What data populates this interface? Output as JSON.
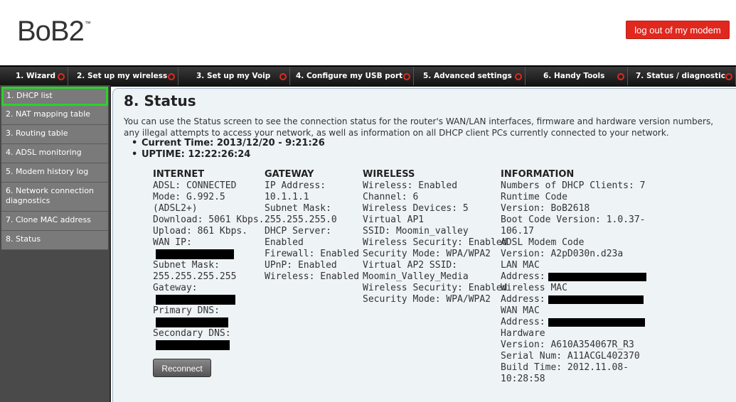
{
  "header": {
    "logo": "BoB2",
    "logo_tm": "™",
    "logout_label": "log out of my modem"
  },
  "topnav": {
    "tabs": [
      {
        "label": "1. Wizard"
      },
      {
        "label": "2. Set up my wireless"
      },
      {
        "label": "3. Set up my Voip"
      },
      {
        "label": "4. Configure my USB port"
      },
      {
        "label": "5. Advanced settings"
      },
      {
        "label": "6. Handy Tools"
      },
      {
        "label": "7. Status / diagnostic"
      }
    ]
  },
  "sidebar": {
    "items": [
      {
        "label": "1. DHCP list"
      },
      {
        "label": "2. NAT mapping table"
      },
      {
        "label": "3. Routing table"
      },
      {
        "label": "4. ADSL monitoring"
      },
      {
        "label": "5. Modem history log"
      },
      {
        "label": "6. Network connection diagnostics"
      },
      {
        "label": "7. Clone MAC address"
      },
      {
        "label": "8. Status"
      }
    ]
  },
  "main": {
    "title": "8. Status",
    "intro": "You can use the Status screen to see the connection status for the router's WAN/LAN interfaces, firmware and hardware version numbers, any illegal attempts to access your network, as well as information on all DHCP client PCs currently connected to your network.",
    "current_time": "Current Time: 2013/12/20 - 9:21:26",
    "uptime": "UPTIME: 12:22:26:24",
    "reconnect_label": "Reconnect",
    "internet": {
      "heading": "INTERNET",
      "adsl": "ADSL:  CONNECTED",
      "mode1": "Mode:  G.992.5",
      "mode2": "(ADSL2+)",
      "download": "Download:  5061 Kbps.",
      "upload": "Upload:  861 Kbps.",
      "wan_ip": "WAN IP:",
      "subnet_label": "Subnet Mask:",
      "subnet_value": " 255.255.255.255",
      "gateway": "Gateway:",
      "primary_dns": "Primary DNS:",
      "secondary_dns": "Secondary DNS:"
    },
    "gateway": {
      "heading": "GATEWAY",
      "ip_label": "IP Address:",
      "ip_value": " 10.1.1.1",
      "subnet_label": "Subnet Mask:",
      "subnet_value": " 255.255.255.0",
      "dhcp_label": "DHCP Server:",
      "dhcp_value": " Enabled",
      "firewall": "Firewall:  Enabled",
      "upnp": "UPnP:  Enabled",
      "wireless": "Wireless:  Enabled"
    },
    "wireless": {
      "heading": "WIRELESS",
      "wireless": "Wireless:  Enabled",
      "channel": "Channel:  6",
      "devices": "Wireless Devices: 5",
      "vap1": "Virtual AP1",
      "ssid": "SSID: Moomin_valley",
      "security": "Wireless Security:  Enabled",
      "mode": "Security Mode: WPA/WPA2",
      "vap2": "Virtual AP2 SSID:",
      "vap2_ssid": "Moomin_Valley_Media",
      "security2": "Wireless Security:  Enabled",
      "mode2": "Security Mode: WPA/WPA2"
    },
    "information": {
      "heading": "INFORMATION",
      "clients": "Numbers of DHCP Clients: 7",
      "runtime_label": "Runtime Code",
      "runtime_version": "Version: BoB2618",
      "boot_version": "Boot Code Version: 1.0.37-",
      "boot_version2": "106.17",
      "adsl_label": "ADSL Modem Code",
      "adsl_version": "Version: A2pD030n.d23a",
      "lan_mac": "LAN MAC",
      "lan_addr": "Address:",
      "wl_mac": "Wireless MAC",
      "wl_addr": "Address:",
      "wan_mac": "WAN MAC",
      "wan_addr": "Address:",
      "hw_label": "Hardware",
      "hw_version": "Version: A610A354067R_R3",
      "serial": "Serial Num: A11ACGL402370",
      "build1": "Build Time: 2012.11.08-",
      "build2": "10:28:58"
    }
  },
  "colors": {
    "accent": "#e0281f",
    "active_border": "#2bd22b",
    "content_bg": "#eef3f6"
  }
}
